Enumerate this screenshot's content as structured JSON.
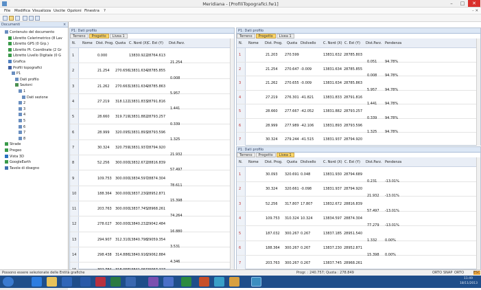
{
  "window": {
    "title": "Meridiana - [ProfiliTopografici.fw1]",
    "minimize": "–",
    "maximize": "□",
    "close": "✕",
    "doc_close": "– ✕"
  },
  "menu": [
    "File",
    "Modifica",
    "Visualizza",
    "Uscite",
    "Opzioni",
    "Finestra",
    "?"
  ],
  "sidebar": {
    "title": "Documenti",
    "items": [
      {
        "label": "Contenuto del documento",
        "indent": 1
      },
      {
        "label": "Libretto Celerimetrico (8 Lav",
        "indent": 2
      },
      {
        "label": "Libretto GPS (0 Grp.)",
        "indent": 2
      },
      {
        "label": "Libretto Pt. Coordinate (2 Gr",
        "indent": 2
      },
      {
        "label": "Libretto Livello Digitale (0 G",
        "indent": 2
      },
      {
        "label": "Grafica",
        "indent": 2
      },
      {
        "label": "Profili topografici",
        "indent": 2
      },
      {
        "label": "P1",
        "indent": 3
      },
      {
        "label": "Dati profilo",
        "indent": 4
      },
      {
        "label": "Sezioni",
        "indent": 4
      },
      {
        "label": "1",
        "indent": 5
      },
      {
        "label": "Dati sezione",
        "indent": 6
      },
      {
        "label": "2",
        "indent": 5
      },
      {
        "label": "3",
        "indent": 5
      },
      {
        "label": "4",
        "indent": 5
      },
      {
        "label": "5",
        "indent": 5
      },
      {
        "label": "6",
        "indent": 5
      },
      {
        "label": "7",
        "indent": 5
      },
      {
        "label": "8",
        "indent": 5
      },
      {
        "label": "Strade",
        "indent": 1
      },
      {
        "label": "Pregeo",
        "indent": 1
      },
      {
        "label": "Vista 3D",
        "indent": 1
      },
      {
        "label": "GoogleEarth",
        "indent": 1
      },
      {
        "label": "Tavole di disegno",
        "indent": 1
      }
    ]
  },
  "left_panel": {
    "title": "P1: Dati profilo",
    "tabs": [
      "Terreno",
      "Progetto",
      "Livea 1"
    ],
    "headers": [
      "N.",
      "Nome",
      "Dist. Prog.",
      "Quota",
      "C. Nord (X)",
      "C. Est (Y)",
      "Dist.Parz."
    ],
    "rows": [
      {
        "n": "1",
        "prog": "0.000",
        "quota": "",
        "x": "13830.922",
        "y": "28764.613"
      },
      {
        "n": "2",
        "prog": "21.254",
        "quota": "270.656",
        "x": "13831.634",
        "y": "28785.855"
      },
      {
        "n": "3",
        "prog": "21.262",
        "quota": "270.663",
        "x": "13831.634",
        "y": "28785.863"
      },
      {
        "n": "4",
        "prog": "27.219",
        "quota": "318.122",
        "x": "13831.833",
        "y": "28791.816"
      },
      {
        "n": "5",
        "prog": "28.660",
        "quota": "319.719",
        "x": "13831.882",
        "y": "28793.257"
      },
      {
        "n": "6",
        "prog": "28.999",
        "quota": "320.095",
        "x": "13831.893",
        "y": "28793.596"
      },
      {
        "n": "7",
        "prog": "30.324",
        "quota": "320.759",
        "x": "13831.937",
        "y": "28794.920"
      },
      {
        "n": "8",
        "prog": "52.256",
        "quota": "300.000",
        "x": "13832.672",
        "y": "28816.839"
      },
      {
        "n": "9",
        "prog": "109.753",
        "quota": "300.000",
        "x": "13834.597",
        "y": "28874.304"
      },
      {
        "n": "10",
        "prog": "188.364",
        "quota": "300.000",
        "x": "13837.230",
        "y": "28952.871"
      },
      {
        "n": "11",
        "prog": "203.763",
        "quota": "300.000",
        "x": "13837.745",
        "y": "28968.261"
      },
      {
        "n": "12",
        "prog": "278.027",
        "quota": "300.000",
        "x": "13840.232",
        "y": "29042.484"
      },
      {
        "n": "13",
        "prog": "294.907",
        "quota": "312.310",
        "x": "13840.798",
        "y": "29059.354"
      },
      {
        "n": "14",
        "prog": "298.438",
        "quota": "314.886",
        "x": "13840.916",
        "y": "29062.884"
      },
      {
        "n": "15",
        "prog": "302.784",
        "quota": "318.055",
        "x": "13841.061",
        "y": "29067.227"
      }
    ],
    "parz": [
      "21.254",
      "0.008",
      "5.957",
      "1.441",
      "0.339",
      "1.325",
      "21.932",
      "57.497",
      "78.611",
      "15.398",
      "74.264",
      "16.880",
      "3.531",
      "4.346",
      "7.577"
    ]
  },
  "right_top": {
    "title": "P1: Dati profilo",
    "tabs": [
      "Terreno",
      "Progetto",
      "Livea 1"
    ],
    "headers": [
      "N.",
      "Nome",
      "Dist. Prog.",
      "Quota",
      "Dislivello",
      "C. Nord (X)",
      "C. Est (Y)",
      "Dist.Parz.",
      "Pendenza"
    ],
    "rows": [
      {
        "n": "1",
        "prog": "21.203",
        "quota": "270.599",
        "dis": "",
        "x": "13831.632",
        "y": "28785.803"
      },
      {
        "n": "2",
        "prog": "21.254",
        "quota": "270.647",
        "dis": "-0.009",
        "x": "13831.634",
        "y": "28785.855"
      },
      {
        "n": "3",
        "prog": "21.262",
        "quota": "270.655",
        "dis": "-0.009",
        "x": "13831.634",
        "y": "28785.863"
      },
      {
        "n": "4",
        "prog": "27.219",
        "quota": "276.301",
        "dis": "-41.821",
        "x": "13831.833",
        "y": "28791.816"
      },
      {
        "n": "5",
        "prog": "28.660",
        "quota": "277.667",
        "dis": "-42.052",
        "x": "13831.882",
        "y": "28793.257"
      },
      {
        "n": "6",
        "prog": "28.999",
        "quota": "277.989",
        "dis": "-42.106",
        "x": "13831.893",
        "y": "28793.596"
      },
      {
        "n": "7",
        "prog": "30.324",
        "quota": "279.244",
        "dis": "-41.515",
        "x": "13831.937",
        "y": "28794.920"
      }
    ],
    "parz": [
      {
        "d": "0.051",
        "p": "94.78%"
      },
      {
        "d": "0.008",
        "p": "94.78%"
      },
      {
        "d": "5.957",
        "p": "94.78%"
      },
      {
        "d": "1.441",
        "p": "94.78%"
      },
      {
        "d": "0.339",
        "p": "94.78%"
      },
      {
        "d": "1.325",
        "p": "94.78%"
      }
    ]
  },
  "right_bottom": {
    "title": "P1: Dati profilo",
    "tabs": [
      "Terreno",
      "Progetto",
      "Livea 1"
    ],
    "headers": [
      "N.",
      "Nome",
      "Dist. Prog.",
      "Quota",
      "Dislivello",
      "C. Nord (X)",
      "C. Est (Y)",
      "Dist.Parz.",
      "Pendenza"
    ],
    "rows": [
      {
        "n": "1",
        "prog": "30.093",
        "quota": "320.691",
        "dis": "0.048",
        "x": "13831.930",
        "y": "28794.689"
      },
      {
        "n": "2",
        "prog": "30.324",
        "quota": "320.661",
        "dis": "-0.098",
        "x": "13831.937",
        "y": "28794.920"
      },
      {
        "n": "3",
        "prog": "52.256",
        "quota": "317.807",
        "dis": "17.807",
        "x": "13832.672",
        "y": "28816.839"
      },
      {
        "n": "4",
        "prog": "109.753",
        "quota": "310.324",
        "dis": "10.324",
        "x": "13834.597",
        "y": "28874.304"
      },
      {
        "n": "5",
        "prog": "187.032",
        "quota": "300.267",
        "dis": "0.267",
        "x": "13837.185",
        "y": "28951.540"
      },
      {
        "n": "6",
        "prog": "188.364",
        "quota": "300.267",
        "dis": "0.267",
        "x": "13837.230",
        "y": "28952.871"
      },
      {
        "n": "7",
        "prog": "203.763",
        "quota": "300.267",
        "dis": "0.267",
        "x": "13837.745",
        "y": "28968.261"
      }
    ],
    "parz": [
      {
        "d": "0.231",
        "p": "-13.01%"
      },
      {
        "d": "21.932",
        "p": "-13.01%"
      },
      {
        "d": "57.497",
        "p": "-13.01%"
      },
      {
        "d": "77.279",
        "p": "-13.01%"
      },
      {
        "d": "1.332",
        "p": "0.00%"
      },
      {
        "d": "15.398",
        "p": "0.00%"
      }
    ]
  },
  "status": {
    "left": "Possono essere selezionate delle Entità grafiche",
    "mid": "Progr. : 240.757; Quota : 278.849",
    "right": [
      "ORTO",
      "SNAP",
      "ORTO",
      "ESC"
    ]
  },
  "tray": {
    "time": "11:49",
    "date": "18/11/2013"
  }
}
